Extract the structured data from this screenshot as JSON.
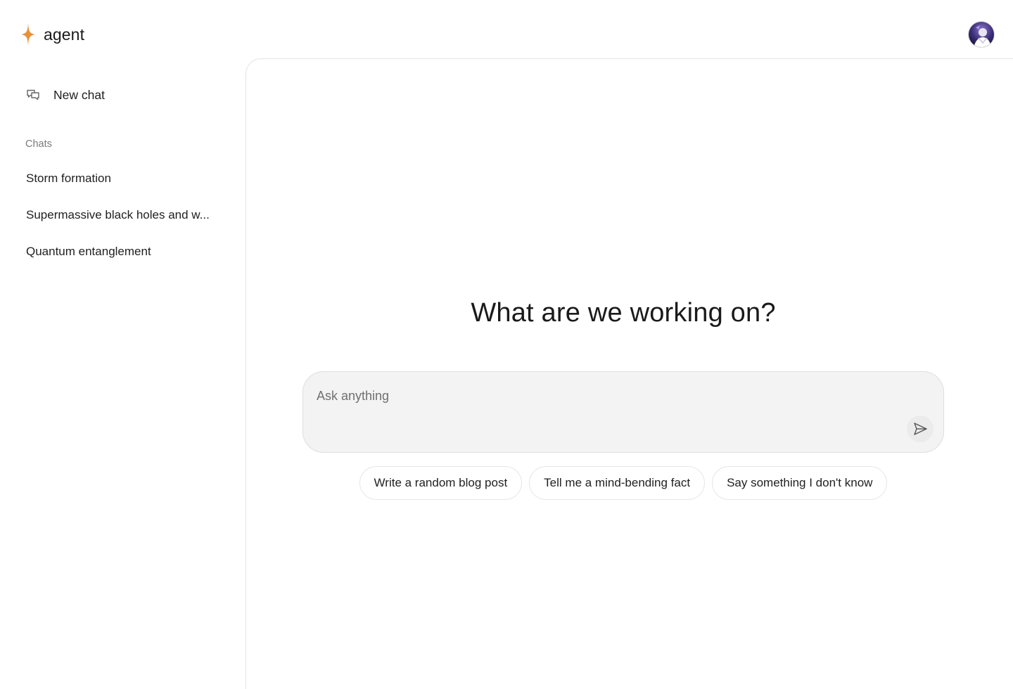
{
  "brand": {
    "name": "agent",
    "icon": "sparkle-icon",
    "accent_color": "#e8913a"
  },
  "user": {
    "avatar": "user-avatar"
  },
  "sidebar": {
    "new_chat_label": "New chat",
    "new_chat_icon": "chat-bubbles-icon",
    "section_label": "Chats",
    "chats": [
      {
        "label": "Storm formation"
      },
      {
        "label": "Supermassive black holes and w..."
      },
      {
        "label": "Quantum entanglement"
      }
    ]
  },
  "main": {
    "headline": "What are we working on?",
    "composer": {
      "placeholder": "Ask anything",
      "value": "",
      "send_icon": "send-icon"
    },
    "suggestions": [
      {
        "label": "Write a random blog post"
      },
      {
        "label": "Tell me a mind-bending fact"
      },
      {
        "label": "Say something I don't know"
      }
    ]
  }
}
